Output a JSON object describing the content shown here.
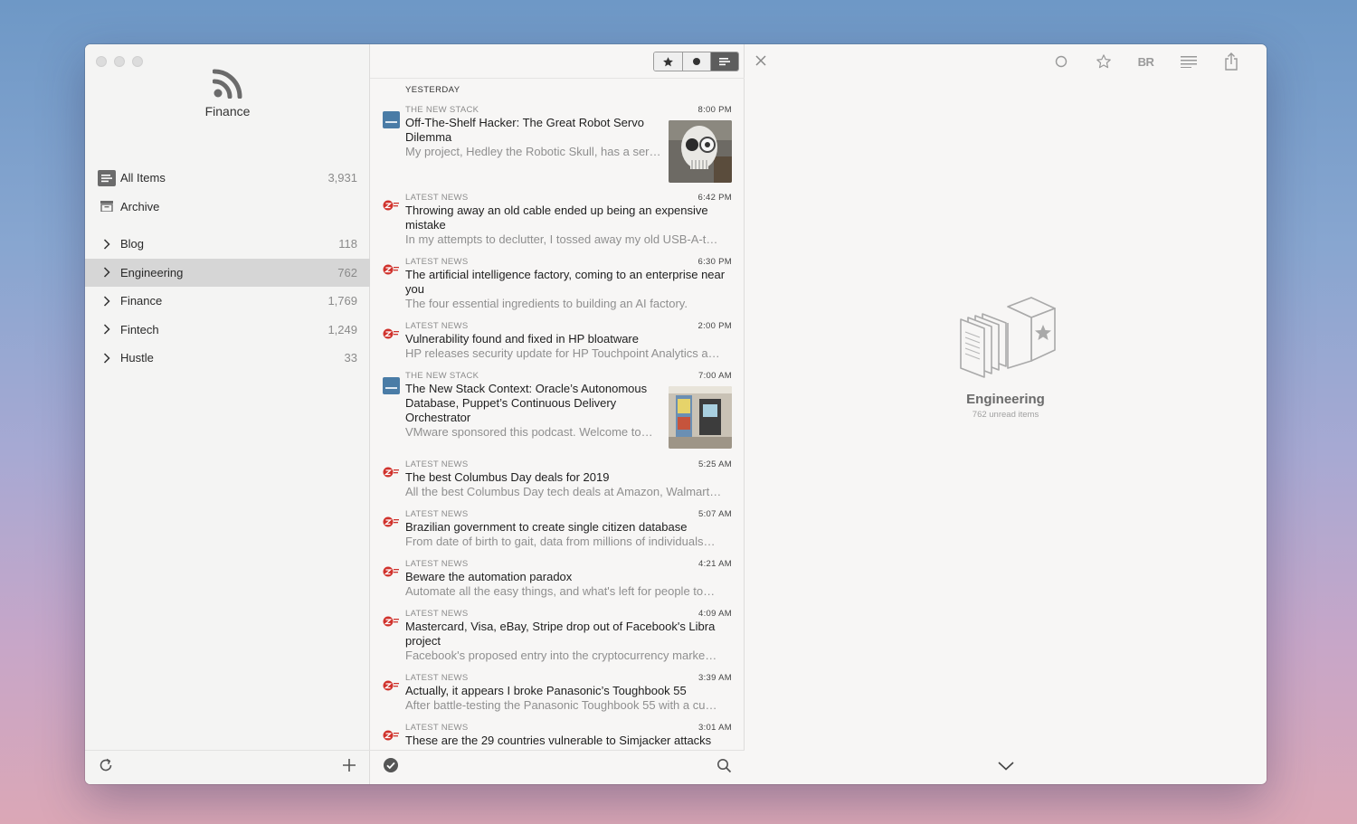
{
  "sidebar": {
    "feed_title": "Finance",
    "top_items": [
      {
        "label": "All Items",
        "count": "3,931"
      },
      {
        "label": "Archive",
        "count": ""
      }
    ],
    "folders": [
      {
        "label": "Blog",
        "count": "118"
      },
      {
        "label": "Engineering",
        "count": "762"
      },
      {
        "label": "Finance",
        "count": "1,769"
      },
      {
        "label": "Fintech",
        "count": "1,249"
      },
      {
        "label": "Hustle",
        "count": "33"
      }
    ]
  },
  "list": {
    "section": "YESTERDAY",
    "articles": [
      {
        "source": "THE NEW STACK",
        "time": "8:00 PM",
        "title": "Off-The-Shelf Hacker: The Great Robot Servo Dilemma",
        "summary": "My project, Hedley the Robotic Skull, has a servo that pans his head back and forth. I’ll so…",
        "icon": "new-stack-icon",
        "thumb": "skull"
      },
      {
        "source": "LATEST NEWS",
        "time": "6:42 PM",
        "title": "Throwing away an old cable ended up being an expensive mistake",
        "summary": "In my attempts to declutter, I tossed away my old USB-A-t…",
        "icon": "zdnet-icon"
      },
      {
        "source": "LATEST NEWS",
        "time": "6:30 PM",
        "title": "The artificial intelligence factory, coming to an enterprise near you",
        "summary": "The four essential ingredients to building an AI factory.",
        "icon": "zdnet-icon"
      },
      {
        "source": "LATEST NEWS",
        "time": "2:00 PM",
        "title": "Vulnerability found and fixed in HP bloatware",
        "summary": "HP releases security update for HP Touchpoint Analytics a…",
        "icon": "zdnet-icon"
      },
      {
        "source": "THE NEW STACK",
        "time": "7:00 AM",
        "title": "The New Stack Context: Oracle’s Autonomous Database, Puppet’s Continuous Delivery Orchestrator",
        "summary": "VMware sponsored this podcast. Welcome to…",
        "icon": "new-stack-icon",
        "thumb": "arcade"
      },
      {
        "source": "LATEST NEWS",
        "time": "5:25 AM",
        "title": "The best Columbus Day deals for 2019",
        "summary": "All the best Columbus Day tech deals at Amazon, Walmart…",
        "icon": "zdnet-icon"
      },
      {
        "source": "LATEST NEWS",
        "time": "5:07 AM",
        "title": "Brazilian government to create single citizen database",
        "summary": "From date of birth to gait, data from millions of individuals…",
        "icon": "zdnet-icon"
      },
      {
        "source": "LATEST NEWS",
        "time": "4:21 AM",
        "title": "Beware the automation paradox",
        "summary": "Automate all the easy things, and what's left for people to…",
        "icon": "zdnet-icon"
      },
      {
        "source": "LATEST NEWS",
        "time": "4:09 AM",
        "title": "Mastercard, Visa, eBay, Stripe drop out of Facebook's Libra project",
        "summary": "Facebook's proposed entry into the cryptocurrency marke…",
        "icon": "zdnet-icon"
      },
      {
        "source": "LATEST NEWS",
        "time": "3:39 AM",
        "title": "Actually, it appears I broke Panasonic’s Toughbook 55",
        "summary": "After battle-testing the Panasonic Toughbook 55 with a cu…",
        "icon": "zdnet-icon"
      },
      {
        "source": "LATEST NEWS",
        "time": "3:01 AM",
        "title": "These are the 29 countries vulnerable to Simjacker attacks",
        "summary": "",
        "icon": "zdnet-icon"
      }
    ]
  },
  "detail": {
    "toolbar_br": "BR",
    "empty_title": "Engineering",
    "empty_subtitle": "762 unread items"
  },
  "colors": {
    "accent_selected": "#d6d6d6",
    "new_stack_blue": "#4a7ca6",
    "zdnet_red": "#d0322c"
  }
}
